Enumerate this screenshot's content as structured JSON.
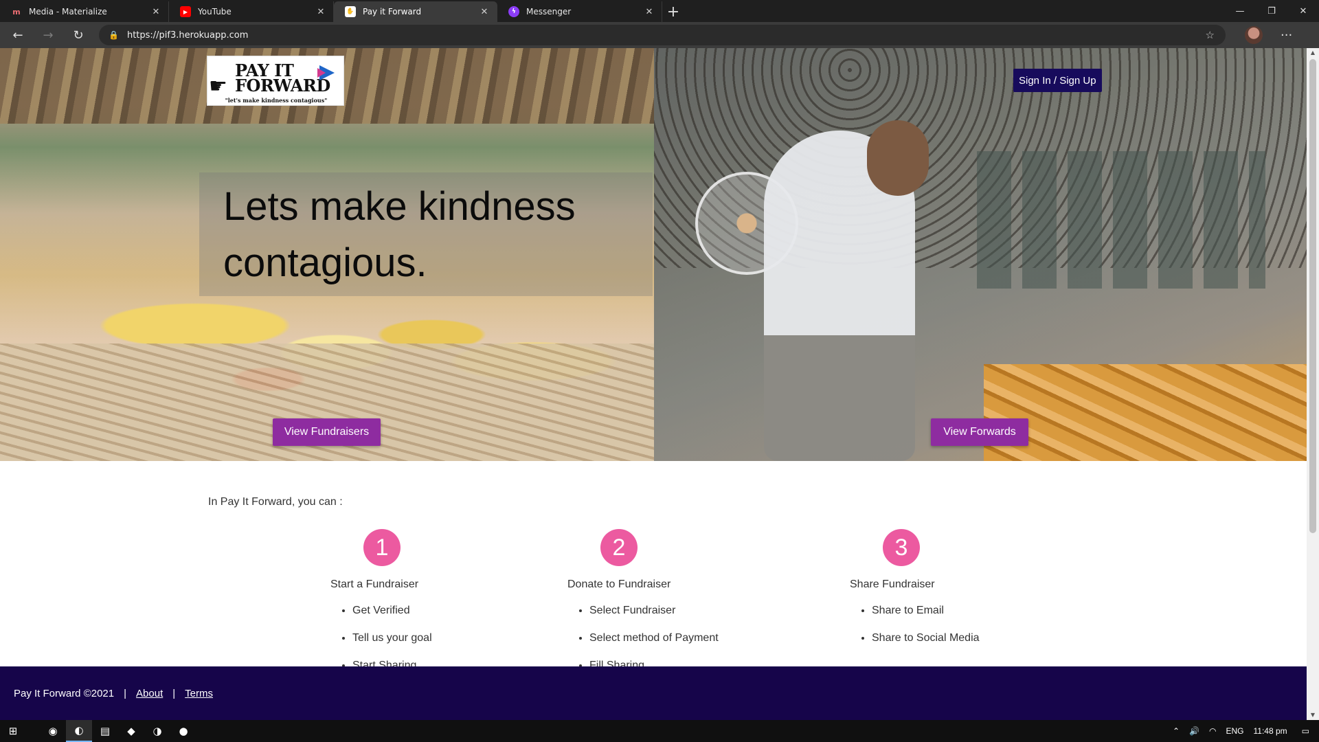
{
  "browser": {
    "tabs": [
      {
        "label": "Media - Materialize",
        "icon": "materialize-icon",
        "active": false
      },
      {
        "label": "YouTube",
        "icon": "youtube-icon",
        "active": false
      },
      {
        "label": "Pay it Forward",
        "icon": "payitforward-icon",
        "active": true
      },
      {
        "label": "Messenger",
        "icon": "messenger-icon",
        "active": false
      }
    ],
    "url": "https://pif3.herokuapp.com"
  },
  "logo": {
    "text_line1": "PAY IT",
    "text_line2": "FORWARD",
    "tagline": "\"let's make kindness contagious\""
  },
  "header": {
    "signin_label": "Sign In / Sign Up"
  },
  "hero": {
    "headline": "Lets make kindness contagious.",
    "left_button": "View Fundraisers",
    "right_button": "View Forwards"
  },
  "content": {
    "intro": "In Pay It Forward, you can :",
    "steps": [
      {
        "number": "1",
        "title": "Start a Fundraiser",
        "items": [
          "Get Verified",
          "Tell us your goal",
          "Start Sharing"
        ]
      },
      {
        "number": "2",
        "title": "Donate to Fundraiser",
        "items": [
          "Select Fundraiser",
          "Select method of Payment",
          "Fill Sharing"
        ]
      },
      {
        "number": "3",
        "title": "Share Fundraiser",
        "items": [
          "Share to Email",
          "Share to Social Media"
        ]
      }
    ]
  },
  "footer": {
    "copyright": "Pay It Forward ©2021",
    "about": "About",
    "terms": "Terms"
  },
  "taskbar": {
    "language": "ENG",
    "time": "11:48 pm"
  },
  "colors": {
    "accent_purple": "#8e2ca0",
    "navy": "#170b5c",
    "footer": "#16054a",
    "step_circle": "#ec5aa0"
  }
}
